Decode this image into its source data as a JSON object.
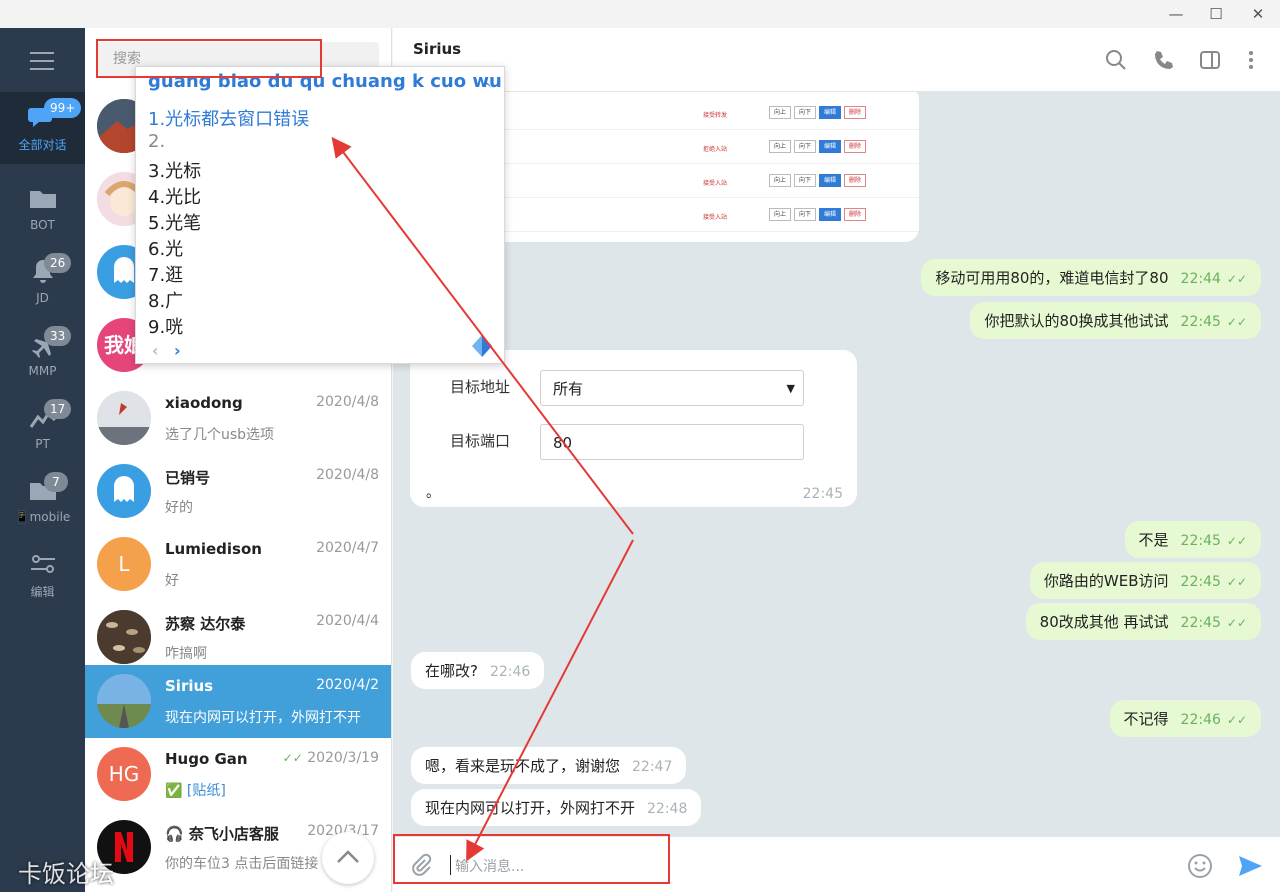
{
  "window": {
    "minimize": "—",
    "maximize": "☐",
    "close": "✕"
  },
  "rail": {
    "items": [
      {
        "label": "全部对话",
        "badge": "99+"
      },
      {
        "label": "BOT",
        "badge": ""
      },
      {
        "label": "JD",
        "badge": "26"
      },
      {
        "label": "MMP",
        "badge": "33"
      },
      {
        "label": "PT",
        "badge": "17"
      },
      {
        "label": "📱mobile",
        "badge": "7"
      },
      {
        "label": "编辑",
        "badge": ""
      }
    ]
  },
  "search": {
    "placeholder": "搜索"
  },
  "chats": [
    {
      "name": "xiaodong",
      "date": "2020/4/8",
      "preview": "选了几个usb选项"
    },
    {
      "name": "已销号",
      "date": "2020/4/8",
      "preview": "好的"
    },
    {
      "name": "Lumiedison",
      "date": "2020/4/7",
      "preview": "好",
      "initial": "L"
    },
    {
      "name": "苏察 达尔泰",
      "date": "2020/4/4",
      "preview": "咋搞啊"
    },
    {
      "name": "Sirius",
      "date": "2020/4/2",
      "preview": "现在内网可以打开，外网打不开"
    },
    {
      "name": "Hugo Gan",
      "date": "2020/3/19",
      "preview_icon": "✅",
      "preview": "[贴纸]",
      "initial": "HG"
    },
    {
      "name": "奈飞小店客服",
      "date": "2020/3/17",
      "preview": "你的车位3 点击后面链接"
    }
  ],
  "partial_avatar_text": "我娘",
  "header": {
    "title": "Sirius"
  },
  "messages": [
    {
      "dir": "out",
      "text": "移动可用用80的，难道电信封了80",
      "time": "22:44"
    },
    {
      "dir": "out",
      "text": "你把默认的80换成其他试试",
      "time": "22:45"
    },
    {
      "dir": "out",
      "text": "不是",
      "time": "22:45"
    },
    {
      "dir": "out",
      "text": "你路由的WEB访问",
      "time": "22:45"
    },
    {
      "dir": "out",
      "text": "80改成其他 再试试",
      "time": "22:45"
    },
    {
      "dir": "in",
      "text": "在哪改?",
      "time": "22:46"
    },
    {
      "dir": "out",
      "text": "不记得",
      "time": "22:46"
    },
    {
      "dir": "in",
      "text": "嗯，看来是玩不成了，谢谢您",
      "time": "22:47"
    },
    {
      "dir": "in",
      "text": "现在内网可以打开，外网打不开",
      "time": "22:48"
    }
  ],
  "form_card": {
    "label1": "目标地址",
    "value1": "所有",
    "label2": "目标端口",
    "value2": "80",
    "caption": "。",
    "time": "22:45"
  },
  "shot_card": {
    "rows": [
      {
        "status": "接受转发"
      },
      {
        "status": "拒绝入站"
      },
      {
        "status": "接受入站"
      },
      {
        "status": "接受入站"
      }
    ],
    "btn_up": "向上",
    "btn_down": "向下",
    "btn_edit": "编辑",
    "btn_del": "删除"
  },
  "input": {
    "placeholder": "输入消息..."
  },
  "ime": {
    "pinyin": "guang biao du qu chuang k cuo wu",
    "candidates": [
      "1.光标都去窗口错误",
      "2.",
      "3.光标",
      "4.光比",
      "5.光笔",
      "6.光",
      "7.逛",
      "8.广",
      "9.咣"
    ]
  },
  "watermark": "卡饭论坛",
  "colors": {
    "rail": "#2b3a4c",
    "accent": "#419fd9",
    "out_bubble": "#e6f9d2",
    "annotation": "#e53935"
  }
}
